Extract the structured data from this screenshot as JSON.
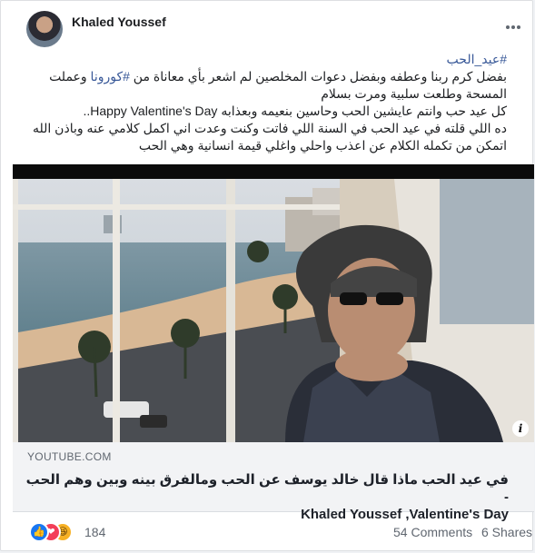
{
  "post": {
    "author": "Khaled Youssef",
    "hashtag_line": "#عيد_الحب",
    "lines": [
      {
        "before": "بفضل كرم ربنا وعطفه وبفضل دعوات المخلصين لم اشعر بأي معاناة من ",
        "tag": "#كورونا",
        "after": " وعملت"
      },
      {
        "text": "المسحة وطلعت سلبية ومرت بسلام"
      },
      {
        "text": "كل عيد حب وانتم عايشين الحب وحاسين بنعيمه  وبعذابه Happy Valentine's Day.."
      },
      {
        "text": "ده اللي قلته في عيد الحب في السنة اللي فاتت وكنت وعدت اني اكمل كلامي عنه وباذن الله"
      },
      {
        "text": "اتمكن من تكمله الكلام عن اعذب واحلي واغلي قيمة انسانية وهي الحب"
      }
    ]
  },
  "link": {
    "domain": "YOUTUBE.COM",
    "title_line1": "في عيد الحب ماذا قال خالد يوسف عن الحب ومالفرق بينه وبين وهم الحب -",
    "title_line2": "Khaled Youssef ,Valentine's Day"
  },
  "footer": {
    "reaction_count": "184",
    "comments": "54 Comments",
    "shares": "6 Shares"
  },
  "icons": {
    "like": "like-reaction-icon",
    "love": "love-reaction-icon",
    "haha": "haha-reaction-icon",
    "info": "info-icon",
    "more": "more-options-icon"
  },
  "colors": {
    "link": "#385898",
    "text": "#1c1e21",
    "like": "#1877f2",
    "love": "#f33e58",
    "haha": "#f7b125"
  }
}
